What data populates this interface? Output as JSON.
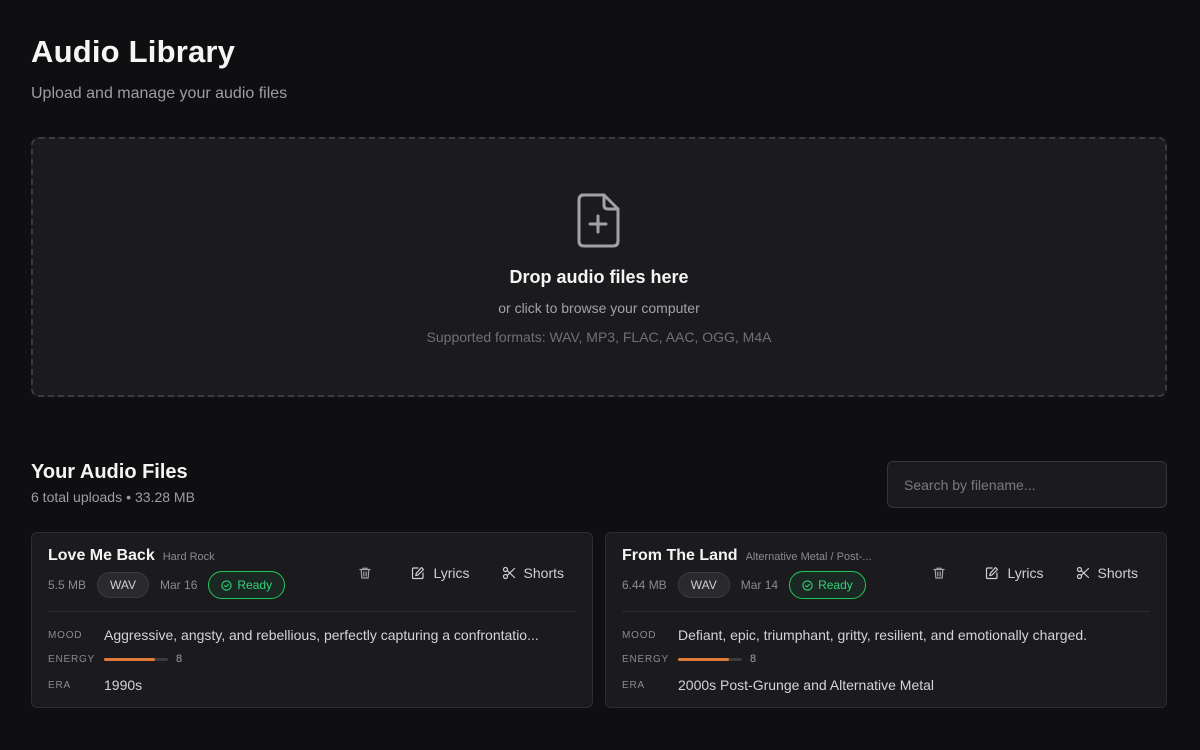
{
  "header": {
    "title": "Audio Library",
    "subtitle": "Upload and manage your audio files"
  },
  "dropzone": {
    "icon": "file-plus-icon",
    "title": "Drop audio files here",
    "subtitle": "or click to browse your computer",
    "formats": "Supported formats: WAV, MP3, FLAC, AAC, OGG, M4A"
  },
  "files_section": {
    "title": "Your Audio Files",
    "total": "6 total uploads",
    "size": "33.28 MB",
    "search_placeholder": "Search by filename..."
  },
  "labels": {
    "mood": "MOOD",
    "energy": "ENERGY",
    "era": "ERA",
    "lyrics": "Lyrics",
    "shorts": "Shorts"
  },
  "colors": {
    "accent_energy": "#e07a3a",
    "status_ready": "#22c55e"
  },
  "files": [
    {
      "title": "Love Me Back",
      "genre": "Hard Rock",
      "size": "5.5 MB",
      "format": "WAV",
      "date": "Mar 16",
      "status": "Ready",
      "mood": "Aggressive, angsty, and rebellious, perfectly capturing a confrontatio...",
      "energy": "8",
      "energy_fraction": 0.8,
      "era": "1990s"
    },
    {
      "title": "From The Land",
      "genre": "Alternative Metal / Post-...",
      "size": "6.44 MB",
      "format": "WAV",
      "date": "Mar 14",
      "status": "Ready",
      "mood": "Defiant, epic, triumphant, gritty, resilient, and emotionally charged.",
      "energy": "8",
      "energy_fraction": 0.8,
      "era": "2000s Post-Grunge and Alternative Metal"
    }
  ]
}
